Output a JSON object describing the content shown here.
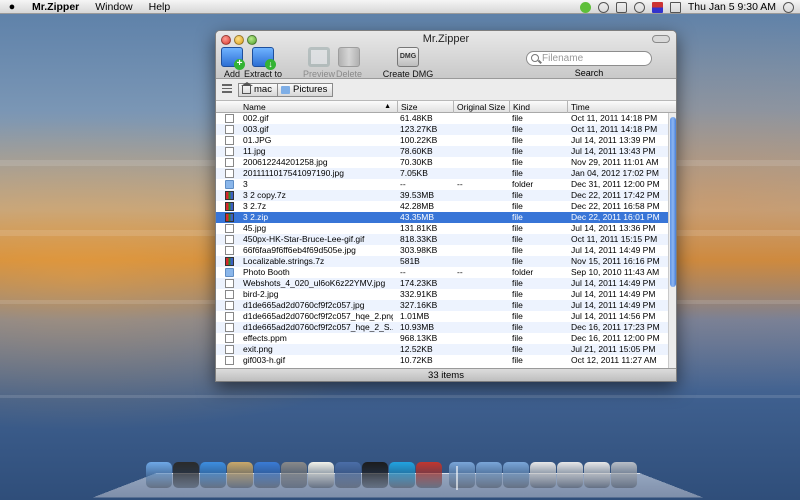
{
  "menubar": {
    "apple_symbol": "",
    "app_name": "Mr.Zipper",
    "menus": [
      "Window",
      "Help"
    ],
    "clock": "Thu Jan 5  9:30 AM"
  },
  "window": {
    "title": "Mr.Zipper",
    "toolbar": {
      "add": "Add",
      "extract": "Extract to",
      "preview": "Preview",
      "delete": "Delete",
      "dmg_icon_text": "DMG",
      "create_dmg": "Create DMG",
      "search_placeholder": "Filename",
      "search_label": "Search"
    },
    "path": {
      "home": "mac",
      "folder": "Pictures"
    },
    "columns": {
      "name": "Name",
      "size": "Size",
      "original_size": "Original Size",
      "kind": "Kind",
      "time": "Time",
      "sort_indicator": "▲"
    },
    "rows": [
      {
        "icon": "file",
        "name": "002.gif",
        "size": "61.48KB",
        "orig": "",
        "kind": "file",
        "time": "Oct 11, 2011 14:18 PM"
      },
      {
        "icon": "file",
        "name": "003.gif",
        "size": "123.27KB",
        "orig": "",
        "kind": "file",
        "time": "Oct 11, 2011 14:18 PM"
      },
      {
        "icon": "file",
        "name": "01.JPG",
        "size": "100.22KB",
        "orig": "",
        "kind": "file",
        "time": "Jul 14, 2011 13:39 PM"
      },
      {
        "icon": "file",
        "name": "11.jpg",
        "size": "78.60KB",
        "orig": "",
        "kind": "file",
        "time": "Jul 14, 2011 13:43 PM"
      },
      {
        "icon": "file",
        "name": "200612244201258.jpg",
        "size": "70.30KB",
        "orig": "",
        "kind": "file",
        "time": "Nov 29, 2011 11:01 AM"
      },
      {
        "icon": "file",
        "name": "20111110175410971​90.jpg",
        "size": "7.05KB",
        "orig": "",
        "kind": "file",
        "time": "Jan 04, 2012 17:02 PM"
      },
      {
        "icon": "folder",
        "name": "3",
        "size": "--",
        "orig": "--",
        "kind": "folder",
        "time": "Dec 31, 2011 12:00 PM"
      },
      {
        "icon": "zip",
        "name": "3 2 copy.7z",
        "size": "39.53MB",
        "orig": "",
        "kind": "file",
        "time": "Dec 22, 2011 17:42 PM"
      },
      {
        "icon": "zip",
        "name": "3 2.7z",
        "size": "42.28MB",
        "orig": "",
        "kind": "file",
        "time": "Dec 22, 2011 16:58 PM"
      },
      {
        "icon": "zip",
        "name": "3 2.zip",
        "size": "43.35MB",
        "orig": "",
        "kind": "file",
        "time": "Dec 22, 2011 16:01 PM",
        "selected": true
      },
      {
        "icon": "file",
        "name": "45.jpg",
        "size": "131.81KB",
        "orig": "",
        "kind": "file",
        "time": "Jul 14, 2011 13:36 PM"
      },
      {
        "icon": "file",
        "name": "450px-HK-Star-Bruce-Lee-gif.gif",
        "size": "818.33KB",
        "orig": "",
        "kind": "file",
        "time": "Oct 11, 2011 15:15 PM"
      },
      {
        "icon": "file",
        "name": "66f6faa9f6ff6eb4f69d505e.jpg",
        "size": "303.98KB",
        "orig": "",
        "kind": "file",
        "time": "Jul 14, 2011 14:49 PM"
      },
      {
        "icon": "zip",
        "name": "Localizable.strings.7z",
        "size": "581B",
        "orig": "",
        "kind": "file",
        "time": "Nov 15, 2011 16:16 PM"
      },
      {
        "icon": "folder",
        "name": "Photo Booth",
        "size": "--",
        "orig": "--",
        "kind": "folder",
        "time": "Sep 10, 2010 11:43 AM"
      },
      {
        "icon": "file",
        "name": "Webshots_4_020_ul6oK6z22YMV.jpg",
        "size": "174.23KB",
        "orig": "",
        "kind": "file",
        "time": "Jul 14, 2011 14:49 PM"
      },
      {
        "icon": "file",
        "name": "bird-2.jpg",
        "size": "332.91KB",
        "orig": "",
        "kind": "file",
        "time": "Jul 14, 2011 14:49 PM"
      },
      {
        "icon": "file",
        "name": "d1de665ad2d0760cf9f2c057.jpg",
        "size": "327.16KB",
        "orig": "",
        "kind": "file",
        "time": "Jul 14, 2011 14:49 PM"
      },
      {
        "icon": "file",
        "name": "d1de665ad2d0760cf9f2c057_hqe_2.png",
        "size": "1.01MB",
        "orig": "",
        "kind": "file",
        "time": "Jul 14, 2011 14:56 PM"
      },
      {
        "icon": "file",
        "name": "d1de665ad2d0760cf9f2c057_hqe_2_S...",
        "size": "10.93MB",
        "orig": "",
        "kind": "file",
        "time": "Dec 16, 2011 17:23 PM"
      },
      {
        "icon": "file",
        "name": "effects.ppm",
        "size": "968.13KB",
        "orig": "",
        "kind": "file",
        "time": "Dec 16, 2011 12:00 PM"
      },
      {
        "icon": "file",
        "name": "exit.png",
        "size": "12.52KB",
        "orig": "",
        "kind": "file",
        "time": "Jul 21, 2011 15:05 PM"
      },
      {
        "icon": "file",
        "name": "gif003-h.gif",
        "size": "10.72KB",
        "orig": "",
        "kind": "file",
        "time": "Oct 12, 2011 11:27 AM"
      }
    ],
    "status": "33 items"
  },
  "dock": {
    "items": [
      "finder-icon",
      "dashboard-icon",
      "safari-icon",
      "preview-icon",
      "itunes-icon",
      "photo-icon",
      "textedit-icon",
      "xcode-icon",
      "terminal-icon",
      "skype-icon",
      "mrzipper-icon",
      "applications-folder-icon",
      "documents-folder-icon",
      "downloads-folder-icon",
      "stack-icon",
      "stack-icon-2",
      "stack-icon-3",
      "trash-icon"
    ],
    "colors": [
      "#6fa8e6",
      "#2b2b2b",
      "#3d8ee0",
      "#c9a86a",
      "#3a7bd5",
      "#8a8a8a",
      "#f2f2ea",
      "#4b6ea8",
      "#1c1c1c",
      "#21a3e0",
      "#c2372f",
      "#7aa6d8",
      "#7aa6d8",
      "#7aa6d8",
      "#e8e8e8",
      "#e8e8e8",
      "#e8e8e8",
      "#b9bfc7"
    ]
  }
}
